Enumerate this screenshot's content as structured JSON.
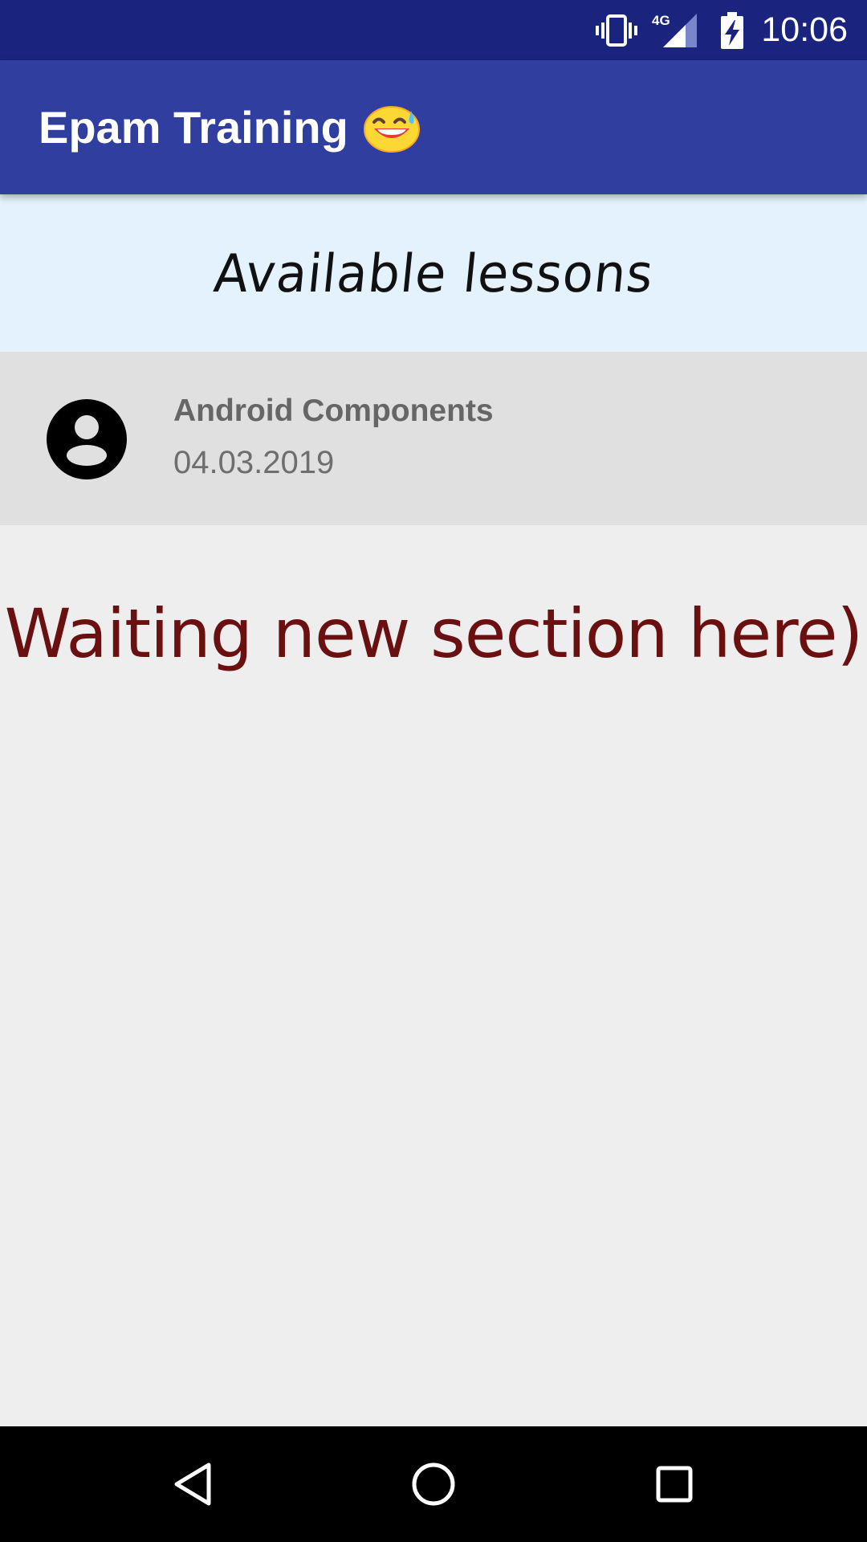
{
  "status_bar": {
    "time": "10:06",
    "network_label": "4G",
    "icons": [
      "vibrate-icon",
      "signal-4g-icon",
      "battery-charging-icon"
    ]
  },
  "app_bar": {
    "title": "Epam Training",
    "emoji_icon": "grinning-sweat-emoji-icon",
    "background": "#303f9f"
  },
  "header": {
    "text": "Available lessons",
    "background": "#e3f2fd"
  },
  "lessons": [
    {
      "title": "Android Components",
      "date": "04.03.2019",
      "icon": "account-circle-icon"
    }
  ],
  "placeholder": {
    "text": "Waiting new section here)",
    "color": "#6b1010"
  },
  "nav_bar": {
    "buttons": [
      "back-icon",
      "home-icon",
      "recents-icon"
    ]
  },
  "colors": {
    "status_bar": "#1a237e",
    "screen_background": "#eeeeee",
    "lesson_row": "#e0e0e0"
  }
}
